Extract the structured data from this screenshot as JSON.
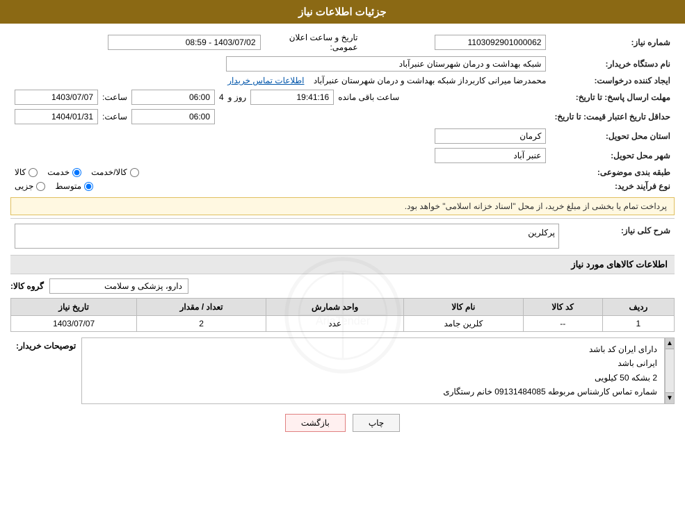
{
  "header": {
    "title": "جزئیات اطلاعات نیاز"
  },
  "fields": {
    "shomara_niaz_label": "شماره نیاز:",
    "shomara_niaz_value": "1103092901000062",
    "nam_dastgah_label": "نام دستگاه خریدار:",
    "nam_dastgah_value": "شبکه بهداشت و درمان شهرستان عنبرآباد",
    "ijad_konande_label": "ایجاد کننده درخواست:",
    "ijad_konande_value": "محمدرضا میرانی کاربرداز  شبکه بهداشت و درمان شهرستان عنبرآباد",
    "ettelaat_tamas": "اطلاعات تماس خریدار",
    "mohlat_label": "مهلت ارسال پاسخ: تا تاریخ:",
    "mohlat_date": "1403/07/07",
    "mohlat_time_label": "ساعت:",
    "mohlat_time": "06:00",
    "mohlat_roz": "4",
    "mohlat_roz_label": "روز و",
    "mohlat_mande": "19:41:16",
    "mohlat_mande_label": "ساعت باقی مانده",
    "hadaqal_label": "حداقل تاریخ اعتبار قیمت: تا تاریخ:",
    "hadaqal_date": "1404/01/31",
    "hadaqal_time_label": "ساعت:",
    "hadaqal_time": "06:00",
    "ostan_label": "استان محل تحویل:",
    "ostan_value": "کرمان",
    "shahr_label": "شهر محل تحویل:",
    "shahr_value": "عنبر آباد",
    "tabaqe_label": "طبقه بندی موضوعی:",
    "tabaqe_options": [
      "کالا",
      "خدمت",
      "کالا/خدمت"
    ],
    "tabaqe_selected": "خدمت",
    "nove_farayand_label": "نوع فرآیند خرید:",
    "nove_farayand_options": [
      "جزیی",
      "متوسط"
    ],
    "nove_farayand_selected": "متوسط",
    "notice": "پرداخت تمام یا بخشی از مبلغ خرید، از محل \"اسناد خزانه اسلامی\" خواهد بود.",
    "sharh_label": "شرح کلی نیاز:",
    "sharh_value": "پرکلرین",
    "kalaها_section": "اطلاعات کالاهای مورد نیاز",
    "group_kala_label": "گروه کالا:",
    "group_kala_value": "دارو، پزشکی و سلامت",
    "table_headers": [
      "ردیف",
      "کد کالا",
      "نام کالا",
      "واحد شمارش",
      "تعداد / مقدار",
      "تاریخ نیاز"
    ],
    "table_rows": [
      {
        "radif": "1",
        "kod_kala": "--",
        "nam_kala": "کلرین جامد",
        "vahed": "عدد",
        "tedad": "2",
        "tarikh": "1403/07/07"
      }
    ],
    "toseeh_label": "توصیحات خریدار:",
    "toseeh_lines": [
      "دارای ایران کد باشد",
      "ایرانی باشد",
      "2 بشکه 50 کیلویی",
      "شماره تماس کارشناس مربوطه 09131484085 خانم رستگاری"
    ]
  },
  "buttons": {
    "print": "چاپ",
    "back": "بازگشت"
  }
}
